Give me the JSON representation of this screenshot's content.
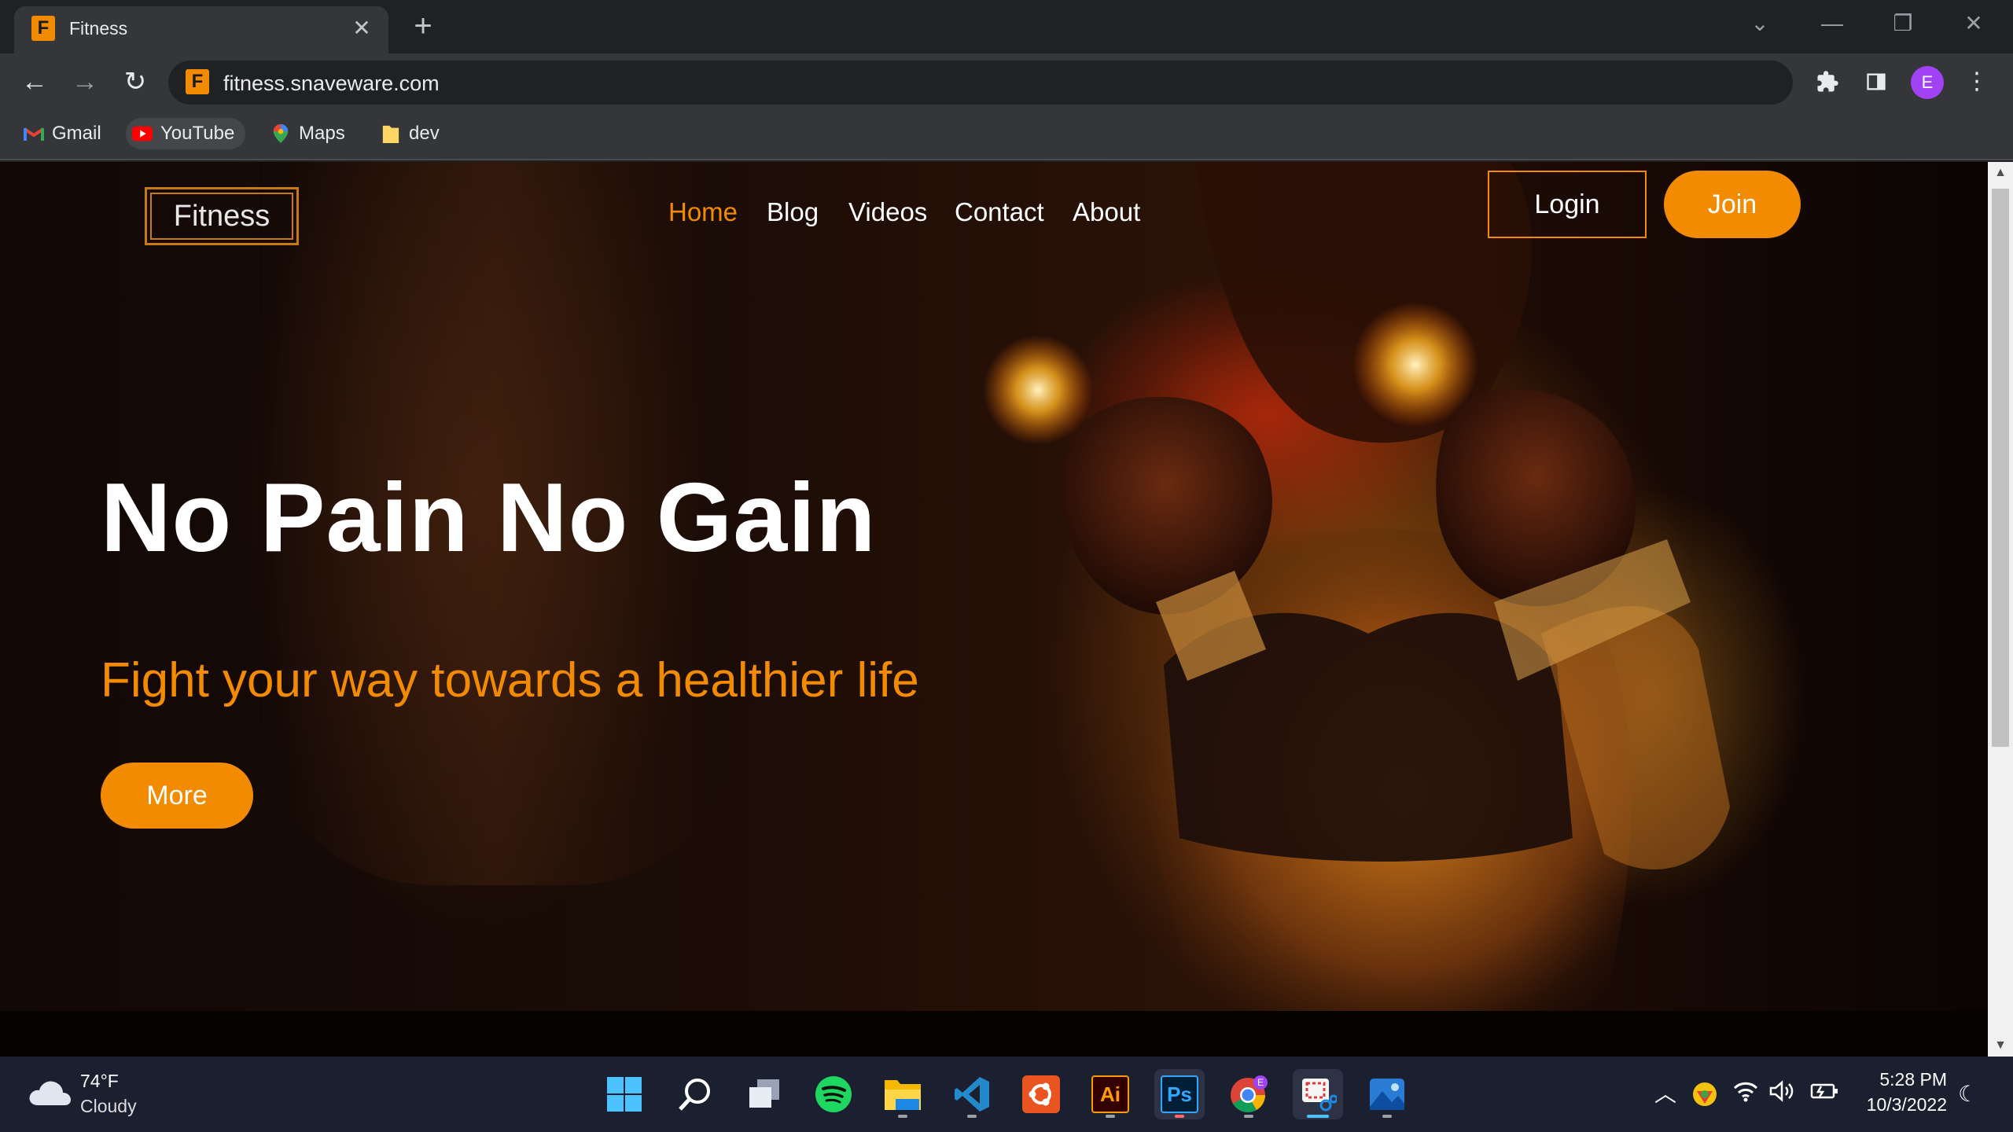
{
  "browser": {
    "tab_title": "Fitness",
    "favicon_letter": "F",
    "url": "fitness.snaveware.com",
    "profile_initial": "E",
    "bookmarks": [
      {
        "label": "Gmail",
        "icon": "gmail-icon"
      },
      {
        "label": "YouTube",
        "icon": "youtube-icon"
      },
      {
        "label": "Maps",
        "icon": "maps-icon"
      },
      {
        "label": "dev",
        "icon": "folder-icon"
      }
    ]
  },
  "site": {
    "logo": "Fitness",
    "nav": [
      {
        "label": "Home",
        "active": true
      },
      {
        "label": "Blog",
        "active": false
      },
      {
        "label": "Videos",
        "active": false
      },
      {
        "label": "Contact",
        "active": false
      },
      {
        "label": "About",
        "active": false
      }
    ],
    "login_label": "Login",
    "join_label": "Join",
    "headline": "No Pain No Gain",
    "subheadline": "Fight your way towards a healthier life",
    "more_label": "More",
    "accent_color": "#f28b00"
  },
  "taskbar": {
    "weather_temp": "74°F",
    "weather_condition": "Cloudy",
    "apps": [
      {
        "name": "start-icon",
        "open": false
      },
      {
        "name": "search-icon",
        "open": false
      },
      {
        "name": "task-view-icon",
        "open": false
      },
      {
        "name": "spotify-icon",
        "open": false
      },
      {
        "name": "file-explorer-icon",
        "open": true
      },
      {
        "name": "vscode-icon",
        "open": true
      },
      {
        "name": "ubuntu-icon",
        "open": false
      },
      {
        "name": "illustrator-icon",
        "open": true,
        "label": "Ai"
      },
      {
        "name": "photoshop-icon",
        "open": true,
        "label": "Ps"
      },
      {
        "name": "chrome-icon",
        "open": true
      },
      {
        "name": "snipping-tool-icon",
        "open": true
      },
      {
        "name": "photos-icon",
        "open": true
      }
    ],
    "time": "5:28 PM",
    "date": "10/3/2022"
  }
}
